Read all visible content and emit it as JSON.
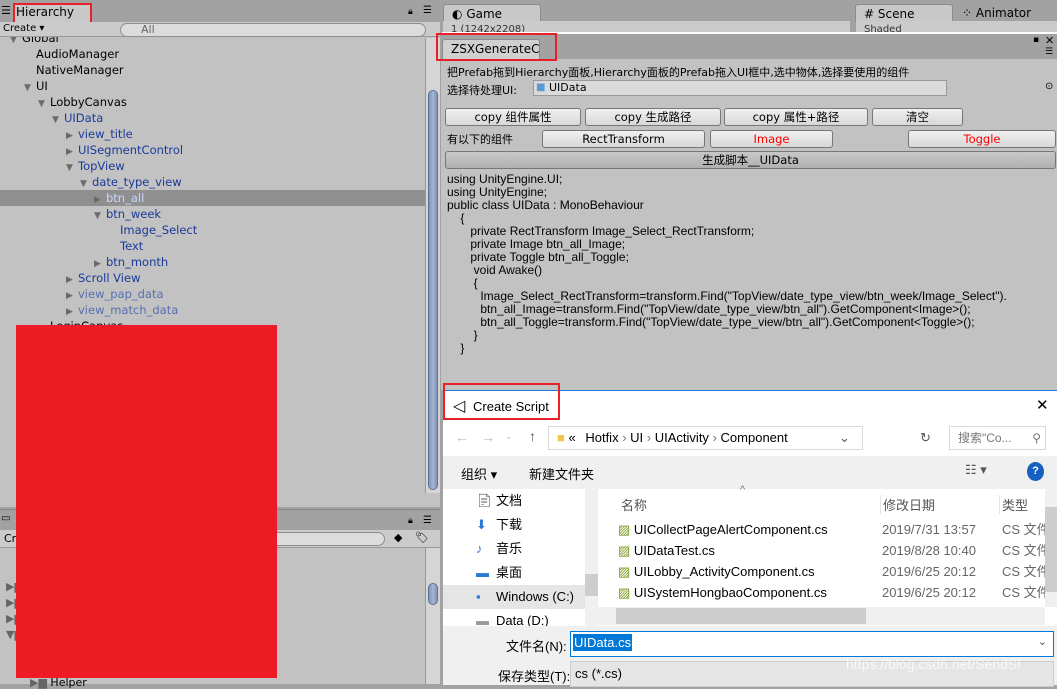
{
  "hierarchy": {
    "tab": "Hierarchy",
    "create": "Create",
    "search_placeholder": "All",
    "items": [
      {
        "label": "Global",
        "depth": 0,
        "arrow": "down",
        "style": "black"
      },
      {
        "label": "AudioManager",
        "depth": 1,
        "arrow": "",
        "style": "black"
      },
      {
        "label": "NativeManager",
        "depth": 1,
        "arrow": "",
        "style": "black"
      },
      {
        "label": "UI",
        "depth": 1,
        "arrow": "down",
        "style": "black"
      },
      {
        "label": "LobbyCanvas",
        "depth": 2,
        "arrow": "down",
        "style": "black"
      },
      {
        "label": "UIData",
        "depth": 3,
        "arrow": "down",
        "style": "blue"
      },
      {
        "label": "view_title",
        "depth": 4,
        "arrow": "right",
        "style": "blue"
      },
      {
        "label": "UISegmentControl",
        "depth": 4,
        "arrow": "right",
        "style": "blue"
      },
      {
        "label": "TopView",
        "depth": 4,
        "arrow": "down",
        "style": "blue"
      },
      {
        "label": "date_type_view",
        "depth": 5,
        "arrow": "down",
        "style": "blue"
      },
      {
        "label": "btn_all",
        "depth": 6,
        "arrow": "right",
        "style": "selected"
      },
      {
        "label": "btn_week",
        "depth": 6,
        "arrow": "down",
        "style": "blue"
      },
      {
        "label": "Image_Select",
        "depth": 7,
        "arrow": "",
        "style": "blue"
      },
      {
        "label": "Text",
        "depth": 7,
        "arrow": "",
        "style": "blue"
      },
      {
        "label": "btn_month",
        "depth": 6,
        "arrow": "right",
        "style": "blue"
      },
      {
        "label": "Scroll View",
        "depth": 4,
        "arrow": "right",
        "style": "blue"
      },
      {
        "label": "view_pap_data",
        "depth": 4,
        "arrow": "right",
        "style": "faint"
      },
      {
        "label": "view_match_data",
        "depth": 4,
        "arrow": "right",
        "style": "faint"
      },
      {
        "label": "LoginCanvas",
        "depth": 2,
        "arrow": "",
        "style": "black"
      }
    ]
  },
  "project": {
    "create": "Cr",
    "helper": "Helper"
  },
  "tabs": {
    "game": "Game",
    "game_toolbar": "1 (1242x2208)",
    "scene": "Scene",
    "scene_toolbar": "Shaded",
    "animator": "Animator"
  },
  "tool": {
    "tab": "ZSXGenerateC",
    "instruction": "把Prefab拖到Hierarchy面板,Hierarchy面板的Prefab拖入UI框中,选中物体,选择要使用的组件",
    "select_label": "选择待处理UI:",
    "selected_object": "UIData",
    "buttons": [
      "copy 组件属性",
      "copy 生成路径",
      "copy 属性+路径",
      "清空"
    ],
    "components_label": "有以下的组件",
    "components": [
      {
        "label": "RectTransform",
        "active": false
      },
      {
        "label": "Image",
        "active": true
      },
      {
        "label": "Toggle",
        "active": true
      }
    ],
    "generate": "生成脚本__UIData",
    "code": "using UnityEngine.UI;\nusing UnityEngine;\npublic class UIData : MonoBehaviour\n    {\n       private RectTransform Image_Select_RectTransform;\n       private Image btn_all_Image;\n       private Toggle btn_all_Toggle;\n        void Awake()\n        {\n          Image_Select_RectTransform=transform.Find(\"TopView/date_type_view/btn_week/Image_Select\").\n          btn_all_Image=transform.Find(\"TopView/date_type_view/btn_all\").GetComponent<Image>();\n          btn_all_Toggle=transform.Find(\"TopView/date_type_view/btn_all\").GetComponent<Toggle>();\n        }\n    }"
  },
  "dialog": {
    "title": "Create Script",
    "path": [
      "Hotfix",
      "UI",
      "UIActivity",
      "Component"
    ],
    "path_prefix": "«",
    "search_placeholder": "搜索\"Co...",
    "organize": "组织",
    "new_folder": "新建文件夹",
    "nav": [
      "文档",
      "下载",
      "音乐",
      "桌面",
      "Windows (C:)",
      "Data (D:)"
    ],
    "columns": [
      "名称",
      "修改日期",
      "类型"
    ],
    "files": [
      {
        "name": "UICollectPageAlertComponent.cs",
        "date": "2019/7/31 13:57",
        "type": "CS 文件"
      },
      {
        "name": "UIDataTest.cs",
        "date": "2019/8/28 10:40",
        "type": "CS 文件"
      },
      {
        "name": "UILobby_ActivityComponent.cs",
        "date": "2019/6/25 20:12",
        "type": "CS 文件"
      },
      {
        "name": "UISystemHongbaoComponent.cs",
        "date": "2019/6/25 20:12",
        "type": "CS 文件"
      }
    ],
    "filename_label": "文件名(N):",
    "filename": "UIData.cs",
    "filetype_label": "保存类型(T):",
    "filetype": "cs (*.cs)"
  },
  "watermark": "https://blog.csdn.net/SendSI",
  "colors": {
    "redaction": "#ed1c24",
    "highlight_box": "#e8202a",
    "selection": "#0078d7"
  }
}
